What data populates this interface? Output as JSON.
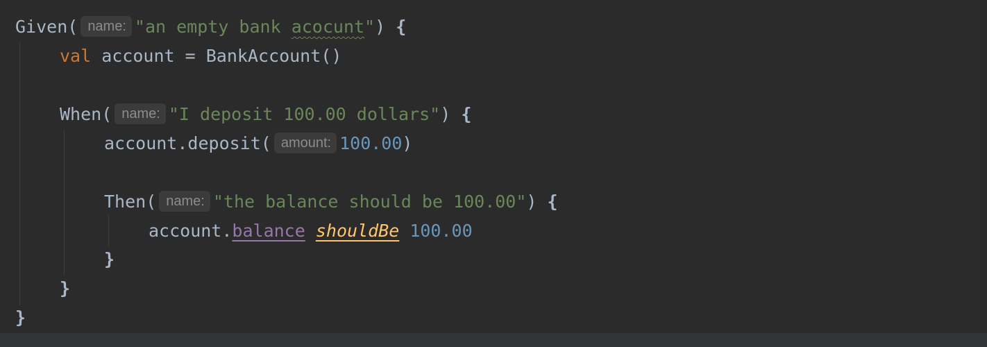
{
  "code": {
    "line1": {
      "fn": "Given(",
      "hint": "name:",
      "str_a": "\"an empty bank ",
      "str_typo": "acocunt",
      "str_b": "\"",
      "close": ") ",
      "brace": "{"
    },
    "line2": {
      "kw": "val",
      "rest": " account = BankAccount()"
    },
    "line4": {
      "fn": "When(",
      "hint": "name:",
      "str": "\"I deposit 100.00 dollars\"",
      "close": ") ",
      "brace": "{"
    },
    "line5": {
      "call": "account.deposit(",
      "hint": "amount:",
      "num": "100.00",
      "close": ")"
    },
    "line7": {
      "fn": "Then(",
      "hint": "name:",
      "str": "\"the balance should be 100.00\"",
      "close": ") ",
      "brace": "{"
    },
    "line8": {
      "obj": "account.",
      "prop": "balance",
      "infix": "shouldBe",
      "num": "100.00"
    },
    "line9": {
      "brace": "}"
    },
    "line10": {
      "brace": "}"
    },
    "line11": {
      "brace": "}"
    }
  },
  "colors": {
    "background": "#2b2b2b",
    "default_text": "#a9b7c6",
    "keyword": "#cc7832",
    "string": "#6a8759",
    "number": "#6897bb",
    "property": "#9876aa",
    "infix_function": "#ffc66d",
    "hint_background": "#3b3b3b",
    "hint_text": "#8c8c8c"
  }
}
